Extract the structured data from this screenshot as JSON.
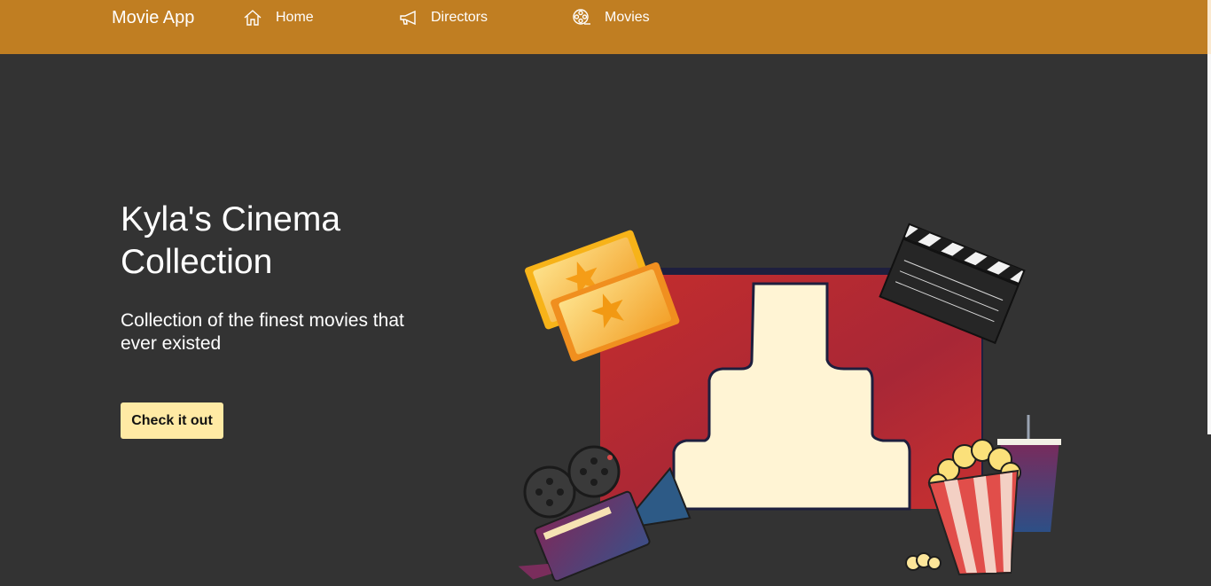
{
  "navbar": {
    "brand": "Movie App",
    "items": [
      {
        "label": "Home",
        "icon": "home-icon"
      },
      {
        "label": "Directors",
        "icon": "megaphone-icon"
      },
      {
        "label": "Movies",
        "icon": "film-reel-icon"
      }
    ],
    "color": "#c07e22"
  },
  "hero": {
    "title": "Kyla's Cinema Collection",
    "subtitle": "Collection of the finest movies that ever existed",
    "button_label": "Check it out",
    "button_color": "#ffeaa4",
    "background": "#333333"
  },
  "illustration": {
    "elements": [
      "theater-curtain",
      "tickets",
      "clapperboard",
      "film-camera",
      "popcorn",
      "soda-cup"
    ]
  }
}
